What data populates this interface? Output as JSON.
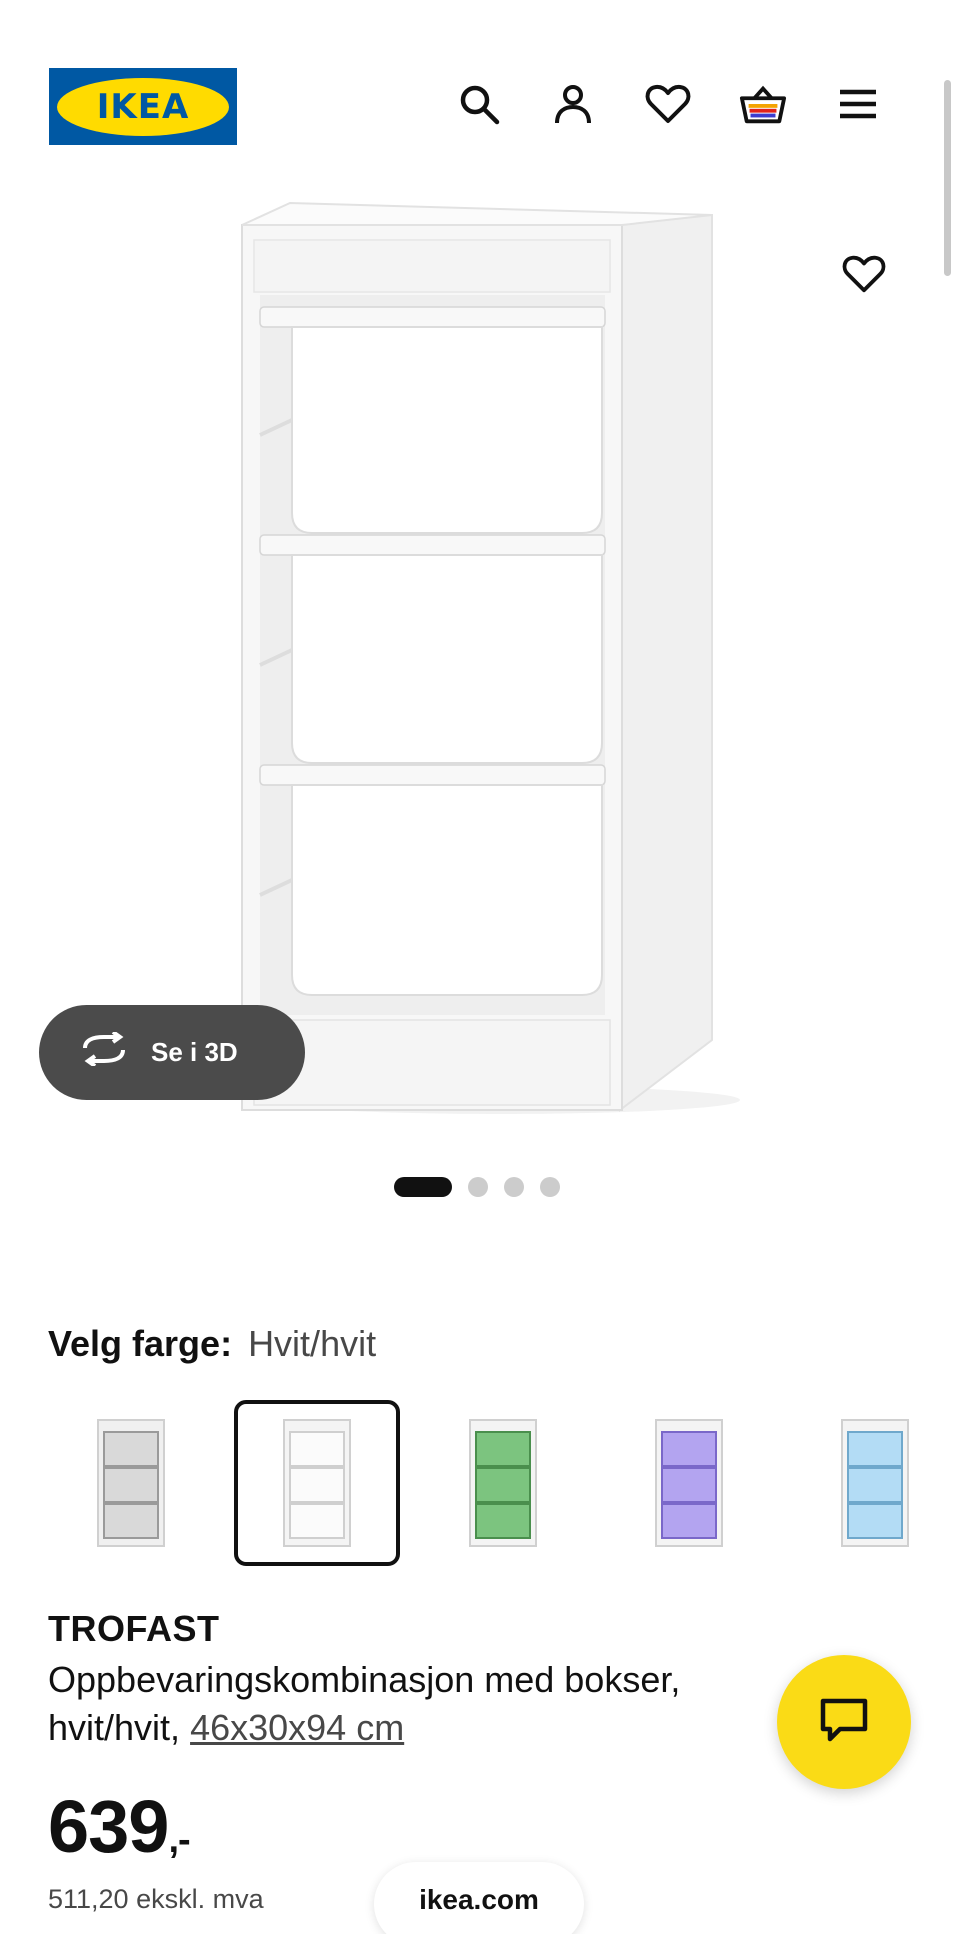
{
  "header": {
    "logo_text": "IKEA",
    "icons": [
      "search-icon",
      "user-icon",
      "heart-icon",
      "cart-icon",
      "menu-icon"
    ]
  },
  "gallery": {
    "view_3d_label": "Se i 3D",
    "image_count": 4,
    "active_image": 1
  },
  "color": {
    "label": "Velg farge:",
    "selected_value": "Hvit/hvit",
    "swatches": [
      {
        "name": "grey",
        "frame": "#f0f0f0",
        "box": "#d9d9d9"
      },
      {
        "name": "white",
        "frame": "#f4f4f4",
        "box": "#f7f7f7"
      },
      {
        "name": "green",
        "frame": "#f4f4f4",
        "box": "#7cc47f"
      },
      {
        "name": "lilac",
        "frame": "#f4f4f4",
        "box": "#b3a4f0"
      },
      {
        "name": "light-blue",
        "frame": "#f4f4f4",
        "box": "#b3dcf5"
      }
    ],
    "selected_index": 1
  },
  "product": {
    "name": "TROFAST",
    "description_line1": "Oppbevaringskombinasjon med bokser,",
    "description_line2_prefix": "hvit/hvit, ",
    "dimensions": "46x30x94 cm",
    "price": "639",
    "price_suffix": ",-",
    "price_ex_vat": "511,20 ekskl. mva"
  },
  "footer": {
    "url": "ikea.com"
  },
  "colors": {
    "brand_blue": "#0058a3",
    "brand_yellow": "#ffdb00",
    "chat_yellow": "#fadb16",
    "button_dark": "#4b4b4b"
  }
}
